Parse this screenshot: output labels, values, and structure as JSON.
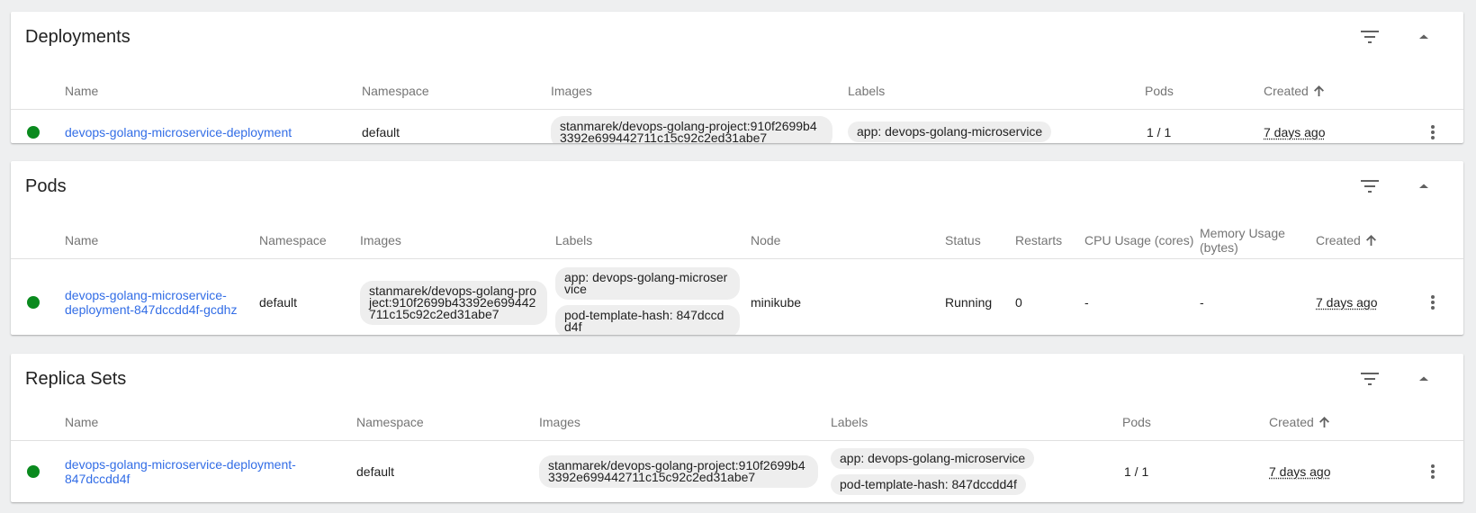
{
  "colors": {
    "status_ok": "#0a8a1e",
    "link": "#326de6",
    "chip_bg": "#eeeeee"
  },
  "icons": {
    "filter": "filter-icon",
    "collapse": "chevron-up-icon",
    "sort": "arrow-up-icon",
    "menu": "more-vert-icon"
  },
  "deployments": {
    "title": "Deployments",
    "headers": {
      "name": "Name",
      "namespace": "Namespace",
      "images": "Images",
      "labels": "Labels",
      "pods": "Pods",
      "created": "Created"
    },
    "rows": [
      {
        "name": "devops-golang-microservice-deployment",
        "namespace": "default",
        "image": "stanmarek/devops-golang-project:910f2699b43392e699442711c15c92c2ed31abe7",
        "labels": [
          "app: devops-golang-microservice"
        ],
        "pods": "1 / 1",
        "created": "7 days ago"
      }
    ]
  },
  "pods": {
    "title": "Pods",
    "headers": {
      "name": "Name",
      "namespace": "Namespace",
      "images": "Images",
      "labels": "Labels",
      "node": "Node",
      "status": "Status",
      "restarts": "Restarts",
      "cpu": "CPU Usage (cores)",
      "memory": "Memory Usage (bytes)",
      "created": "Created"
    },
    "rows": [
      {
        "name": "devops-golang-microservice-deployment-847dccdd4f-gcdhz",
        "namespace": "default",
        "image": "stanmarek/devops-golang-project:910f2699b43392e699442711c15c92c2ed31abe7",
        "labels": [
          "app: devops-golang-microservice",
          "pod-template-hash: 847dccdd4f"
        ],
        "node": "minikube",
        "status": "Running",
        "restarts": "0",
        "cpu": "-",
        "memory": "-",
        "created": "7 days ago"
      }
    ]
  },
  "replicasets": {
    "title": "Replica Sets",
    "headers": {
      "name": "Name",
      "namespace": "Namespace",
      "images": "Images",
      "labels": "Labels",
      "pods": "Pods",
      "created": "Created"
    },
    "rows": [
      {
        "name": "devops-golang-microservice-deployment-847dccdd4f",
        "namespace": "default",
        "image": "stanmarek/devops-golang-project:910f2699b43392e699442711c15c92c2ed31abe7",
        "labels": [
          "app: devops-golang-microservice",
          "pod-template-hash: 847dccdd4f"
        ],
        "pods": "1 / 1",
        "created": "7 days ago"
      }
    ]
  }
}
